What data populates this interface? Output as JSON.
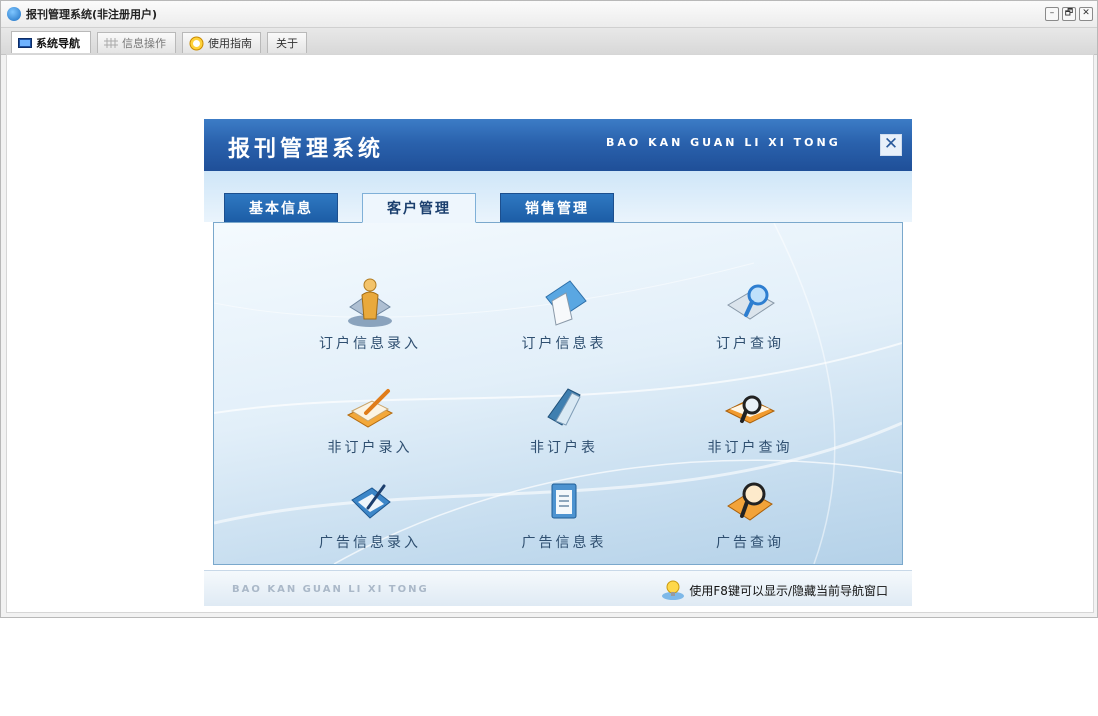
{
  "window": {
    "title": "报刊管理系统(非注册用户)",
    "controls": [
      "–",
      "🗗",
      "✕"
    ]
  },
  "app_tabs": [
    {
      "label": "系统导航",
      "active": true,
      "icon": "monitor-icon"
    },
    {
      "label": "信息操作",
      "active": false,
      "icon": "grid-icon"
    },
    {
      "label": "使用指南",
      "active": false,
      "icon": "help-face-icon"
    },
    {
      "label": "关于",
      "active": false,
      "icon": ""
    }
  ],
  "panel": {
    "title": "报刊管理系统",
    "subtitle": "BAO KAN GUAN LI XI TONG",
    "close": "✕",
    "tabs": [
      {
        "label": "基本信息",
        "active": false
      },
      {
        "label": "客户管理",
        "active": true
      },
      {
        "label": "销售管理",
        "active": false
      }
    ],
    "items": [
      {
        "label": "订户信息录入",
        "icon": "person-icon"
      },
      {
        "label": "订户信息表",
        "icon": "document-icon"
      },
      {
        "label": "订户查询",
        "icon": "magnifier-icon"
      },
      {
        "label": "非订户录入",
        "icon": "notebook-pen-icon"
      },
      {
        "label": "非订户表",
        "icon": "notepad-icon"
      },
      {
        "label": "非订户查询",
        "icon": "magnifier-book-icon"
      },
      {
        "label": "广告信息录入",
        "icon": "clipboard-pen-icon"
      },
      {
        "label": "广告信息表",
        "icon": "clipboard-list-icon"
      },
      {
        "label": "广告查询",
        "icon": "magnifier-orange-icon"
      }
    ],
    "footer": {
      "subtitle": "BAO KAN GUAN LI XI TONG",
      "tip": "使用F8键可以显示/隐藏当前导航窗口",
      "tip_icon": "lightbulb-icon"
    }
  },
  "colors": {
    "banner": "#2a62ad",
    "tab_active": "#eef6fd",
    "tab_inactive": "#1c5da6",
    "label_text": "#2f4f70"
  }
}
